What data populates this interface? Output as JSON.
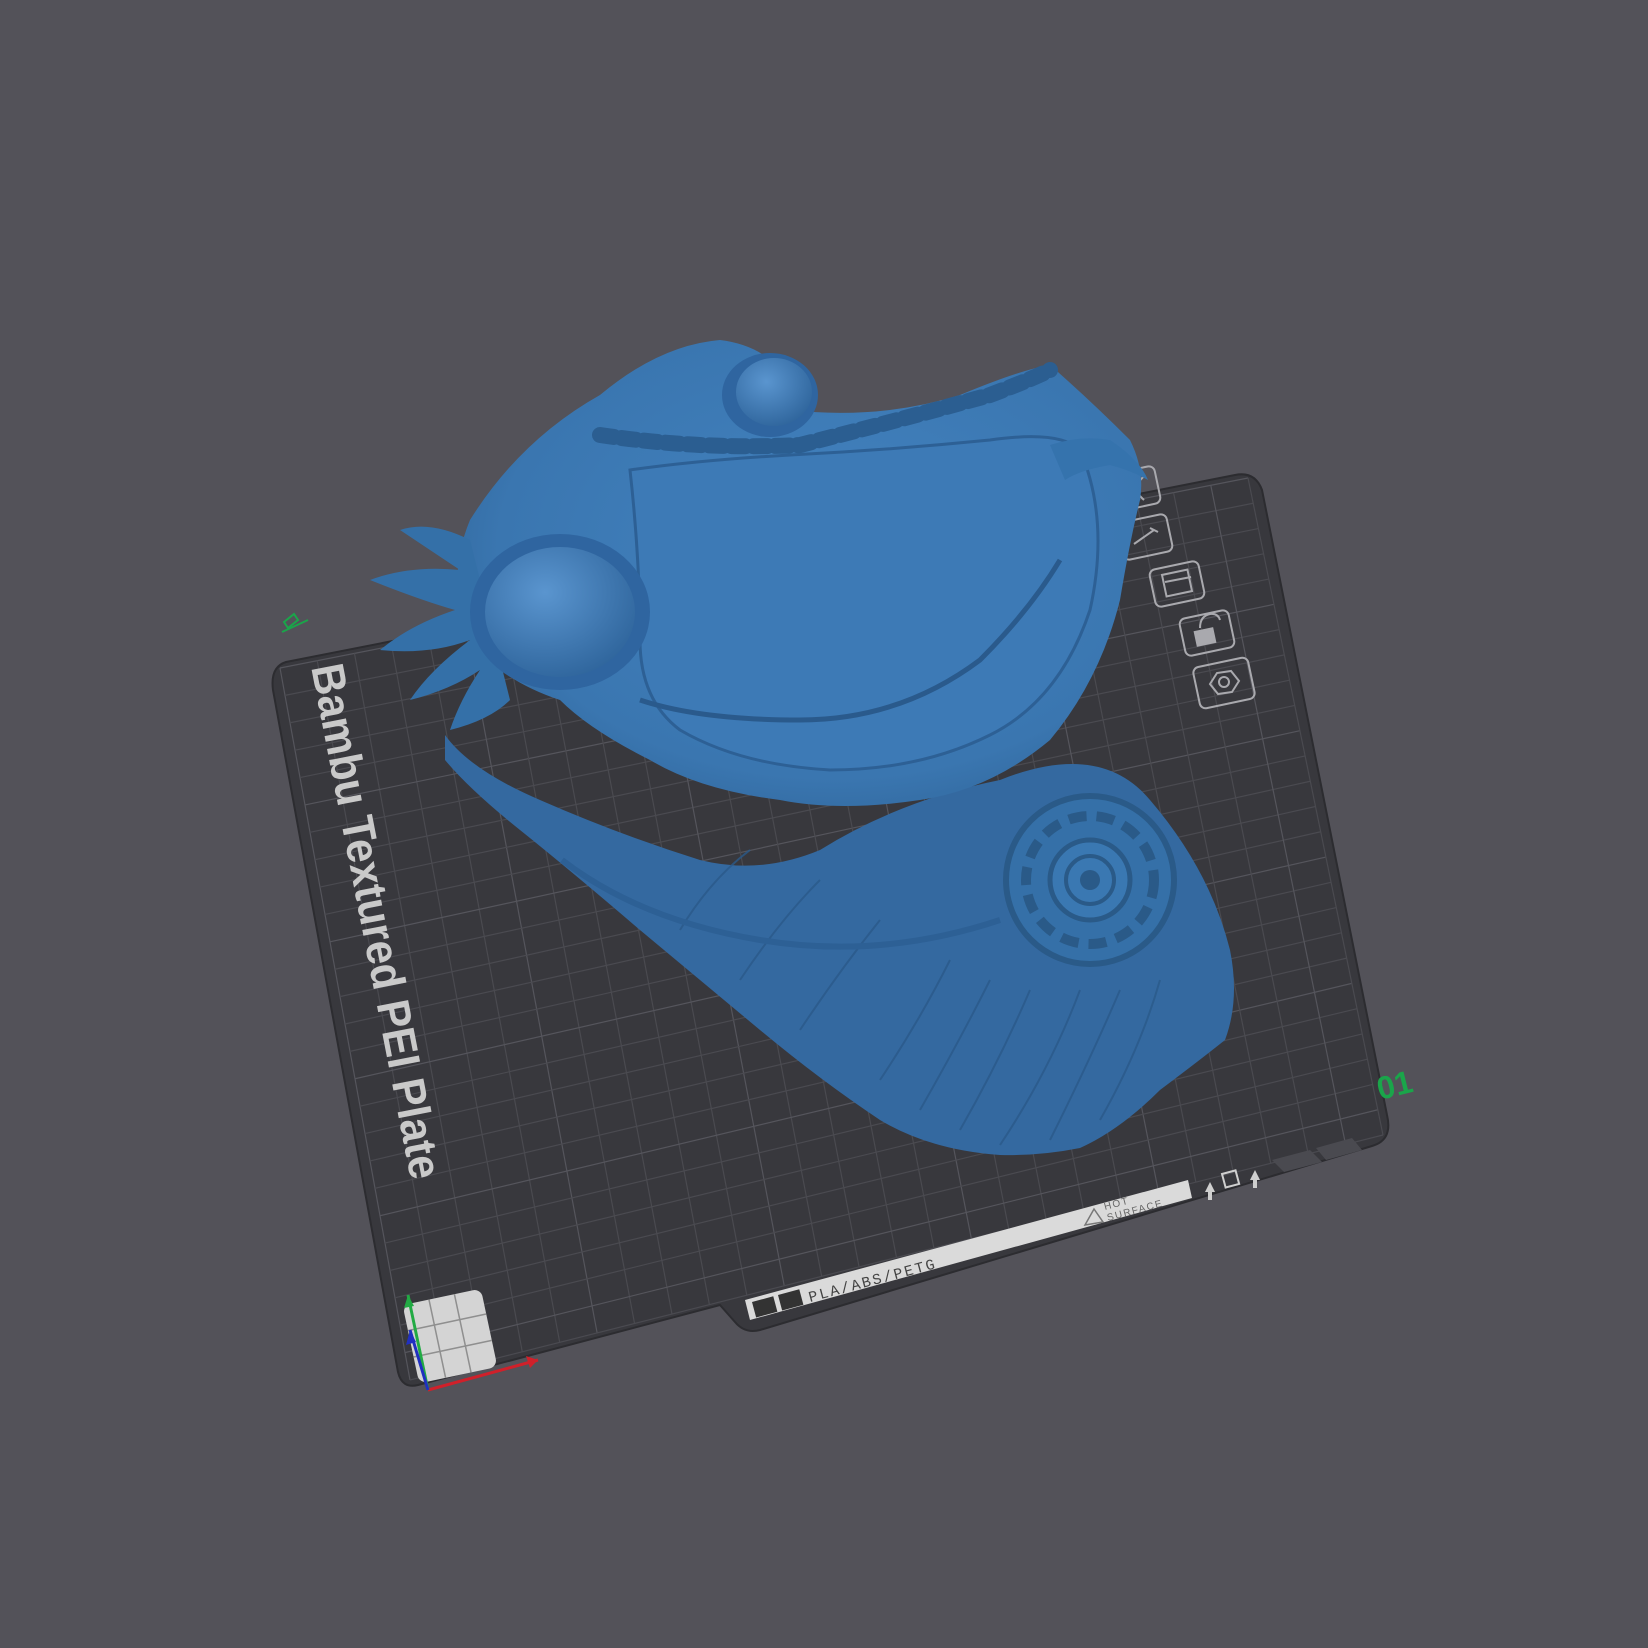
{
  "viewport": {
    "background": "#535259"
  },
  "plate": {
    "name": "Bambu Textured PEI Plate",
    "number": "01",
    "filament_label": "PLA/ABS/PETG",
    "warning_label_line1": "HOT",
    "warning_label_line2": "SURFACE",
    "plate_color": "#38383d",
    "grid_color": "#4a4a50",
    "number_color": "#1aa54a",
    "model_color": "#3a76b0"
  },
  "plate_toolbar": {
    "icons": [
      "close-icon",
      "edit-plate-icon",
      "arrange-icon",
      "lock-icon",
      "settings-icon"
    ]
  },
  "axes": {
    "x_color": "#d0202a",
    "y_color": "#22aa44",
    "z_color": "#2030c0"
  }
}
